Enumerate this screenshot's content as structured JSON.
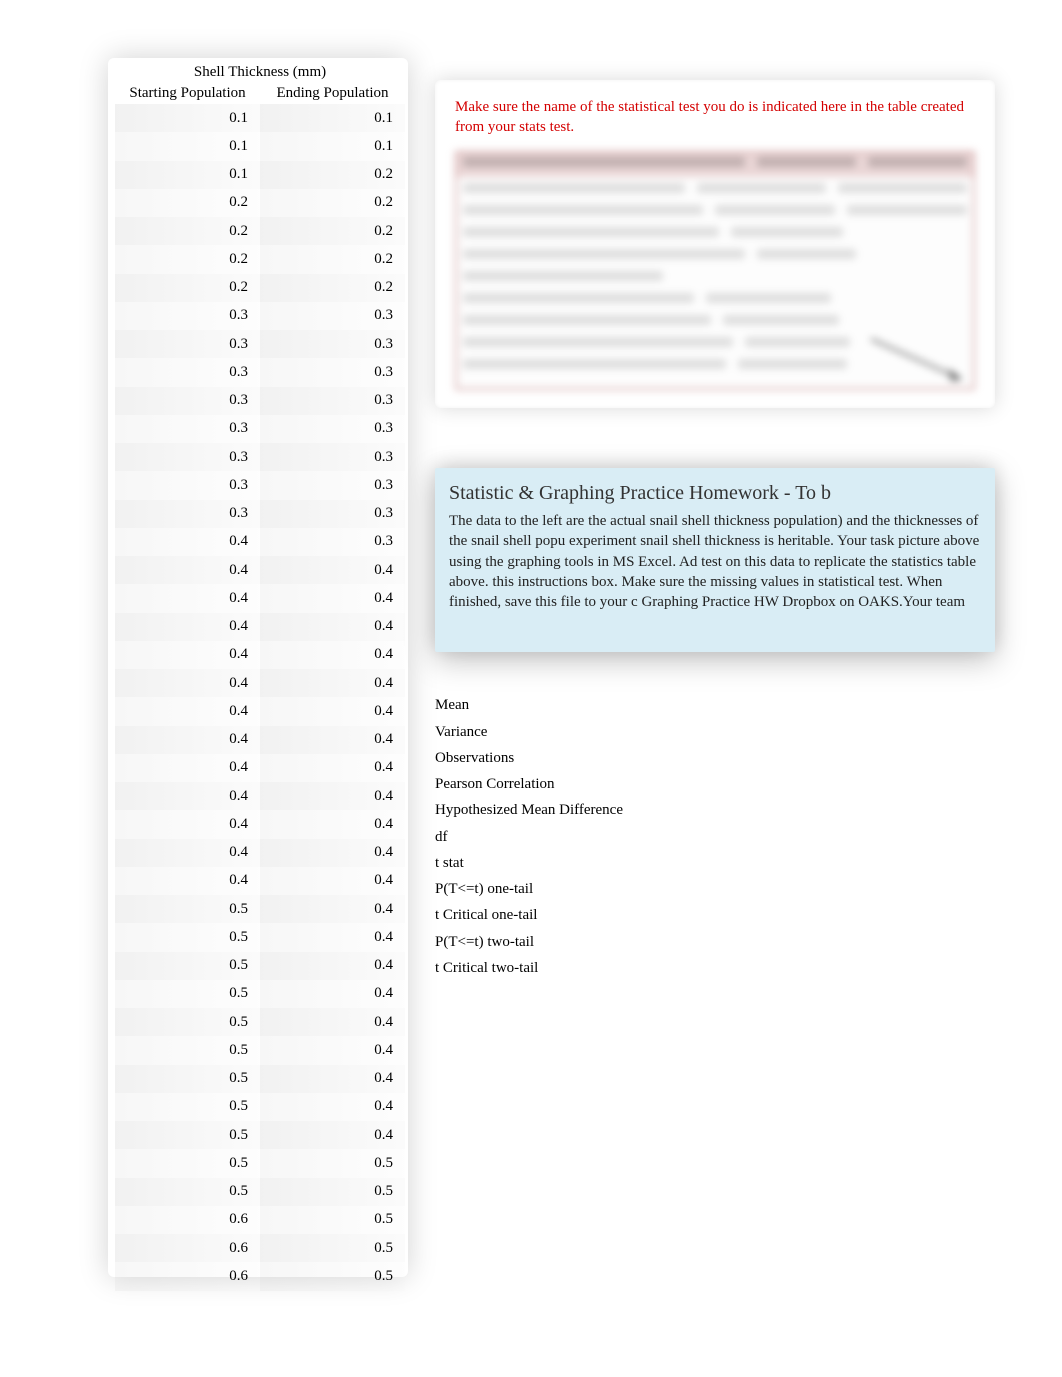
{
  "table": {
    "title": "Shell Thickness (mm)",
    "headers": [
      "Starting Population",
      "Ending Population"
    ],
    "rows": [
      [
        0.1,
        0.1
      ],
      [
        0.1,
        0.1
      ],
      [
        0.1,
        0.2
      ],
      [
        0.2,
        0.2
      ],
      [
        0.2,
        0.2
      ],
      [
        0.2,
        0.2
      ],
      [
        0.2,
        0.2
      ],
      [
        0.3,
        0.3
      ],
      [
        0.3,
        0.3
      ],
      [
        0.3,
        0.3
      ],
      [
        0.3,
        0.3
      ],
      [
        0.3,
        0.3
      ],
      [
        0.3,
        0.3
      ],
      [
        0.3,
        0.3
      ],
      [
        0.3,
        0.3
      ],
      [
        0.4,
        0.3
      ],
      [
        0.4,
        0.4
      ],
      [
        0.4,
        0.4
      ],
      [
        0.4,
        0.4
      ],
      [
        0.4,
        0.4
      ],
      [
        0.4,
        0.4
      ],
      [
        0.4,
        0.4
      ],
      [
        0.4,
        0.4
      ],
      [
        0.4,
        0.4
      ],
      [
        0.4,
        0.4
      ],
      [
        0.4,
        0.4
      ],
      [
        0.4,
        0.4
      ],
      [
        0.4,
        0.4
      ],
      [
        0.5,
        0.4
      ],
      [
        0.5,
        0.4
      ],
      [
        0.5,
        0.4
      ],
      [
        0.5,
        0.4
      ],
      [
        0.5,
        0.4
      ],
      [
        0.5,
        0.4
      ],
      [
        0.5,
        0.4
      ],
      [
        0.5,
        0.4
      ],
      [
        0.5,
        0.4
      ],
      [
        0.5,
        0.5
      ],
      [
        0.5,
        0.5
      ],
      [
        0.6,
        0.5
      ],
      [
        0.6,
        0.5
      ],
      [
        0.6,
        0.5
      ]
    ]
  },
  "red_note": "Make sure the name of the statistical test you do is indicated here in the table created from your stats test.",
  "instructions": {
    "title": "Statistic & Graphing Practice Homework - To b",
    "body": "The data to the left are the actual snail shell thickness population) and the thicknesses of the snail shell popu experiment snail shell thickness is heritable.   Your task picture above using the graphing tools in MS Excel. Ad test on this data to replicate the statistics table above. this instructions box.   Make sure the missing values in statistical test.   When finished, save this file to your c Graphing Practice HW Dropbox on OAKS.Your team"
  },
  "stats_labels": [
    "Mean",
    "Variance",
    "Observations",
    "Pearson Correlation",
    "Hypothesized Mean Difference",
    "df",
    "t stat",
    "P(T<=t) one-tail",
    "t Critical one-tail",
    "P(T<=t) two-tail",
    "t Critical two-tail"
  ]
}
